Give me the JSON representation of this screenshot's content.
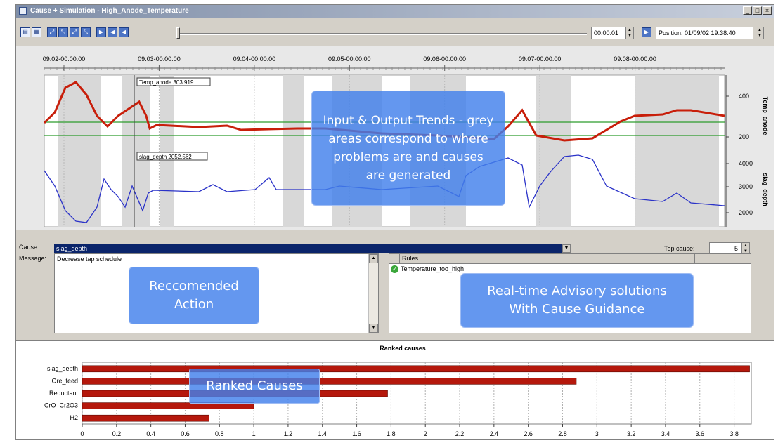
{
  "window": {
    "title": "Cause + Simulation - High_Anode_Temperature",
    "controls": {
      "minimize": "_",
      "restore": "□",
      "close": "×"
    }
  },
  "toolbar": {
    "time_step": "00:00:01",
    "position": "Position: 01/09/02 19:38:40",
    "icons": [
      "chart-icon",
      "grid-icon",
      "zoom-icon",
      "zoom-in-icon",
      "zoom-out-icon",
      "fit-icon",
      "play-icon",
      "step-back-icon",
      "rewind-icon"
    ]
  },
  "trends": {
    "date_labels": [
      "09.02-00:00:00",
      "09.03-00:00:00",
      "09.04-00:00:00",
      "09.05-00:00:00",
      "09.06-00:00:00",
      "09.07-00:00:00",
      "09.08-00:00:00"
    ],
    "top_series": {
      "name": "Temp_anode",
      "cursor_label": "Temp_anode 303.919",
      "ticks": [
        "400",
        "200"
      ],
      "color": "#c81e0a"
    },
    "bottom_series": {
      "name": "slag_depth",
      "cursor_label": "slag_depth 2052.562",
      "ticks": [
        "4000",
        "3000",
        "2000"
      ],
      "color": "#2a32c8"
    },
    "limit_color": "#2c9c2c"
  },
  "cause": {
    "label": "Cause:",
    "value": "slag_depth",
    "top_cause_label": "Top cause:",
    "top_cause_value": "5"
  },
  "message": {
    "label": "Message:",
    "text": "Decrease tap schedule"
  },
  "rules": {
    "header": "Rules",
    "items": [
      "Temperature_too_high"
    ]
  },
  "callouts": {
    "trends": "Input & Output Trends - grey areas correspond to where problems are and causes are generated",
    "action": "Reccomended Action",
    "advisory": "Real-time Advisory solutions With Cause Guidance",
    "ranked": "Ranked Causes"
  },
  "chart_data": {
    "type": "bar",
    "title": "Ranked causes",
    "categories": [
      "slag_depth",
      "Ore_feed",
      "Reductant",
      "CrO_Cr2O3",
      "H2"
    ],
    "values": [
      3.89,
      2.88,
      1.78,
      1.0,
      0.74
    ],
    "xlim": [
      0,
      3.9
    ],
    "xticks": [
      "0",
      "0.2",
      "0.4",
      "0.6",
      "0.8",
      "1",
      "1.2",
      "1.4",
      "1.6",
      "1.8",
      "2",
      "2.2",
      "2.4",
      "2.6",
      "2.8",
      "3",
      "3.2",
      "3.4",
      "3.6",
      "3.8"
    ],
    "bar_color": "#b5180c",
    "orientation": "horizontal",
    "grid": true
  }
}
